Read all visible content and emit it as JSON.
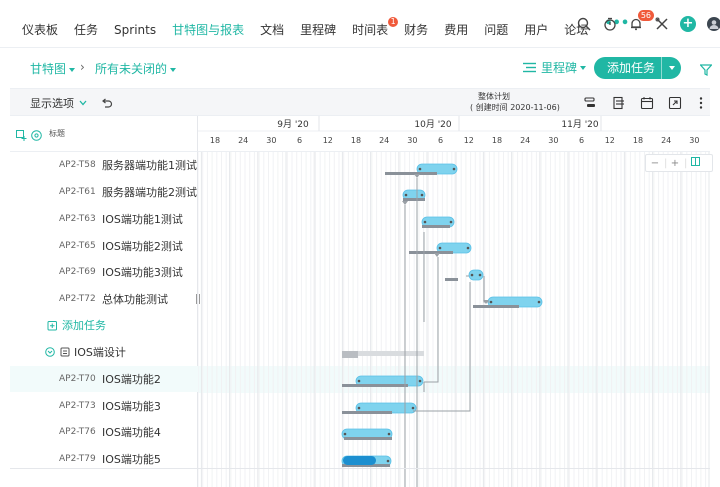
{
  "nav": {
    "items": [
      {
        "label": "仪表板",
        "active": false
      },
      {
        "label": "任务",
        "active": false
      },
      {
        "label": "Sprints",
        "active": false
      },
      {
        "label": "甘特图与报表",
        "active": true
      },
      {
        "label": "文档",
        "active": false
      },
      {
        "label": "里程碑",
        "active": false
      },
      {
        "label": "时间表",
        "active": false,
        "badge": "1"
      },
      {
        "label": "财务",
        "active": false
      },
      {
        "label": "费用",
        "active": false
      },
      {
        "label": "问题",
        "active": false
      },
      {
        "label": "用户",
        "active": false
      },
      {
        "label": "论坛",
        "active": false
      }
    ],
    "more": "•••",
    "bell_badge": "56"
  },
  "toolbar": {
    "view_label": "甘特图",
    "filter_label": "所有未关闭的",
    "milestone_label": "里程碑",
    "add_task_label": "添加任务"
  },
  "subbar": {
    "display_options": "显示选项",
    "plan_title": "整体计划",
    "plan_created": "( 创建时间 2020-11-06)"
  },
  "grid": {
    "title_header": "标题",
    "add_task_label": "添加任务",
    "group_name": "IOS端设计",
    "rows": [
      {
        "id": "AP2-T58",
        "title": "服务器端功能1测试"
      },
      {
        "id": "AP2-T61",
        "title": "服务器端功能2测试"
      },
      {
        "id": "AP2-T63",
        "title": "IOS端功能1测试"
      },
      {
        "id": "AP2-T65",
        "title": "IOS端功能2测试"
      },
      {
        "id": "AP2-T69",
        "title": "IOS端功能3测试"
      },
      {
        "id": "AP2-T72",
        "title": "总体功能测试"
      }
    ],
    "group_rows": [
      {
        "id": "AP2-T70",
        "title": "IOS端功能2"
      },
      {
        "id": "AP2-T73",
        "title": "IOS端功能3"
      },
      {
        "id": "AP2-T76",
        "title": "IOS端功能4"
      },
      {
        "id": "AP2-T79",
        "title": "IOS端功能5"
      }
    ]
  },
  "timeline": {
    "months": [
      {
        "label": "9月 '20"
      },
      {
        "label": "10月 '20"
      },
      {
        "label": "11月 '20"
      }
    ],
    "days": [
      "18",
      "24",
      "30",
      "6",
      "12",
      "18",
      "24",
      "30",
      "6",
      "12",
      "18",
      "24",
      "30",
      "6",
      "12",
      "18",
      "24",
      "30"
    ]
  },
  "zoom": {
    "minus": "−",
    "plus": "+"
  },
  "colors": {
    "accent": "#20b7a4",
    "bar": "#7fd3ee",
    "bar_border": "#5bc0e6",
    "baseline": "#8a9199",
    "badge": "#f05a3b"
  }
}
